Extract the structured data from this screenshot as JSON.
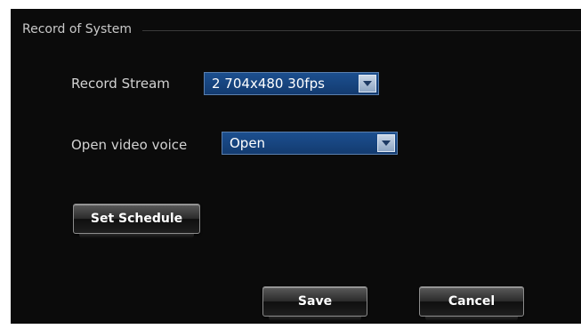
{
  "section": {
    "title": "Record of System"
  },
  "record_stream": {
    "label": "Record Stream",
    "value": "2 704x480 30fps"
  },
  "video_voice": {
    "label": "Open video voice",
    "value": "Open"
  },
  "buttons": {
    "set_schedule": "Set Schedule",
    "save": "Save",
    "cancel": "Cancel"
  },
  "colors": {
    "panel_bg": "#0b0b0b",
    "select_bg": "#1c4f8f",
    "text": "#d2d2d2"
  },
  "icons": {
    "dropdown": "chevron-down-icon"
  }
}
